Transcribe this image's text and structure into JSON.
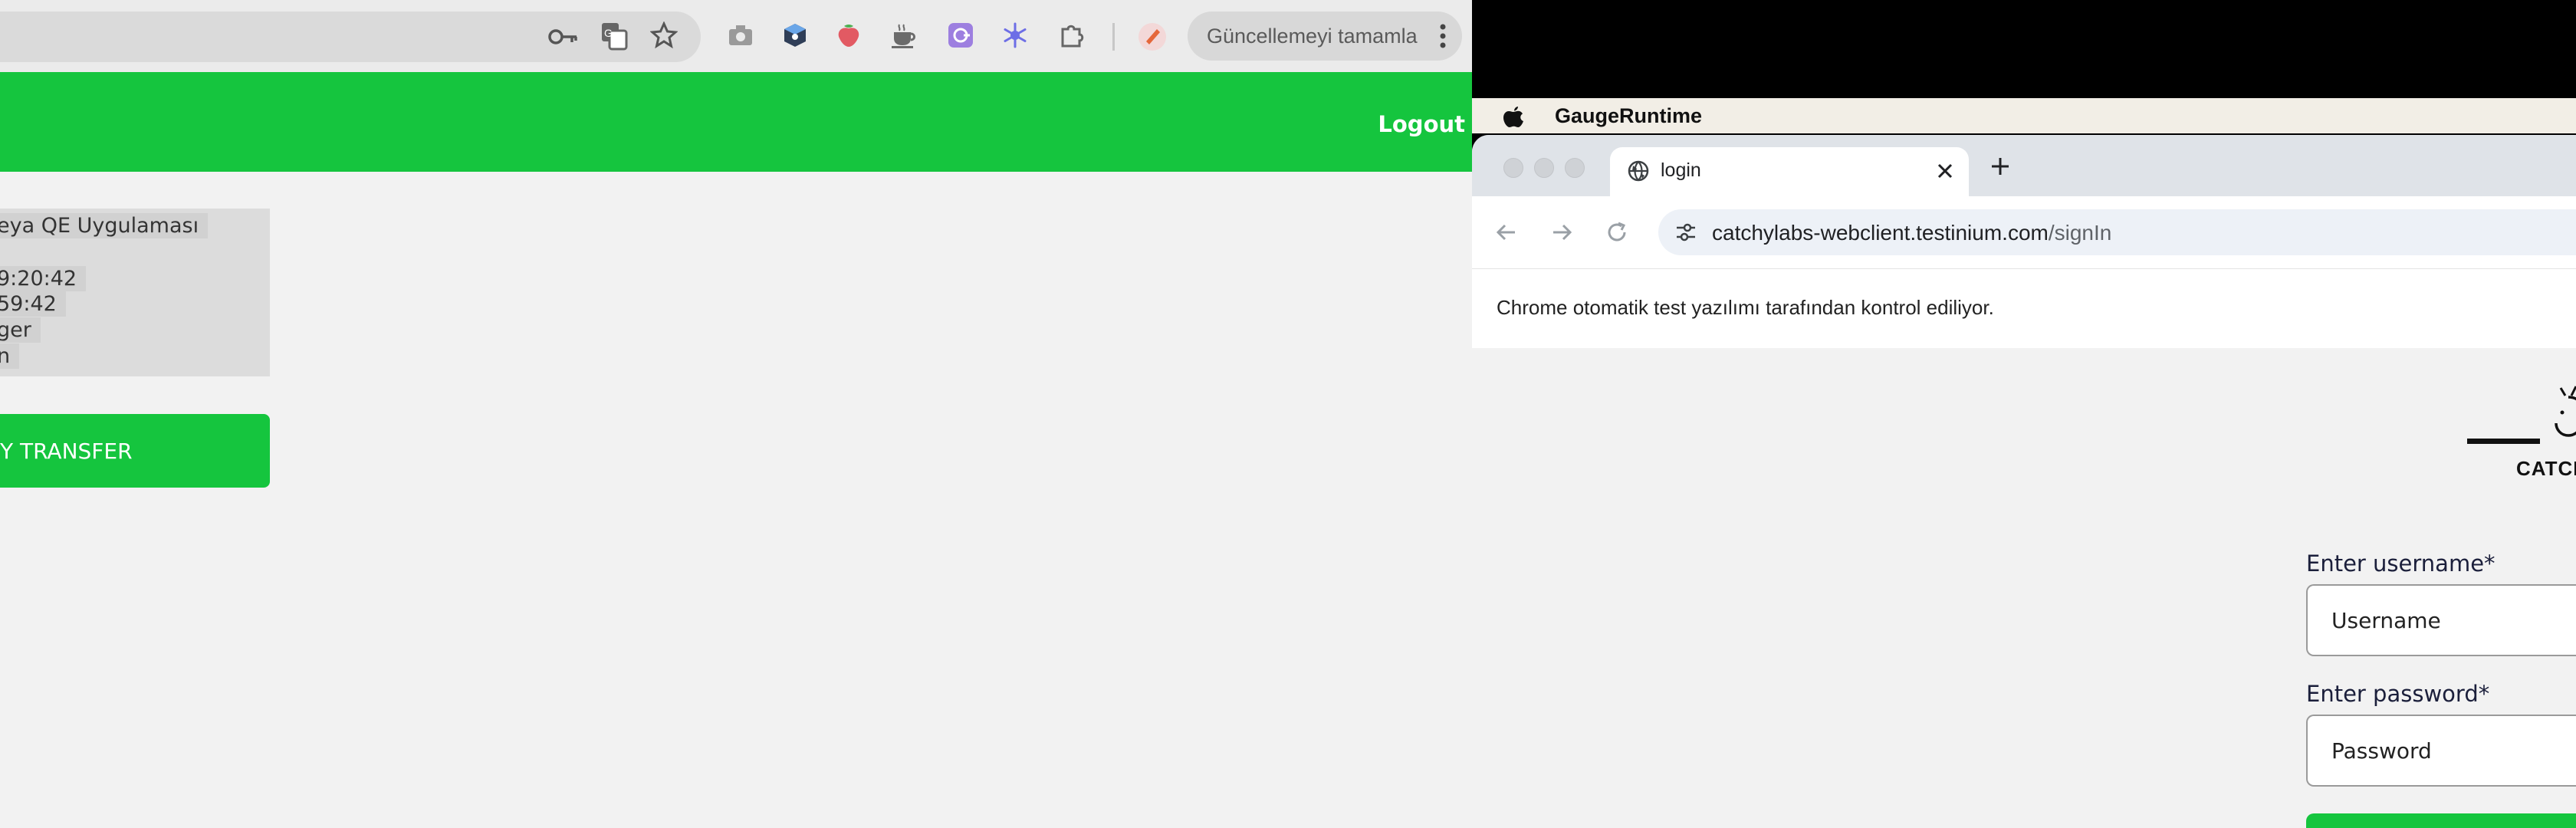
{
  "left_browser": {
    "update_button_label": "Güncellemeyi tamamla",
    "logout_label": "Logout",
    "info_lines": [
      "eya QE Uygulaması",
      "9:20:42",
      "59:42",
      "ger",
      "n"
    ],
    "money_transfer_label": "Y TRANSFER",
    "extension_icons": [
      "camera-icon",
      "cube-extension-icon",
      "strawberry-extension-icon",
      "coffee-extension-icon",
      "purple-extension-icon",
      "snowflake-extension-icon",
      "puzzle-extensions-icon"
    ]
  },
  "macos_menubar": {
    "app_name": "GaugeRuntime"
  },
  "chrome": {
    "tab_title": "login",
    "url_host": "catchylabs-webclient.testinium.com",
    "url_path": "/signIn",
    "automation_notice": "Chrome otomatik test yazılımı tarafından kontrol ediliyor."
  },
  "login_page": {
    "logo_text": "CATCH",
    "username_label": "Enter username*",
    "username_placeholder": "Username",
    "password_label": "Enter password*",
    "password_placeholder": "Password"
  },
  "colors": {
    "brand_green": "#15c53e",
    "page_background": "#f2f2f2"
  }
}
